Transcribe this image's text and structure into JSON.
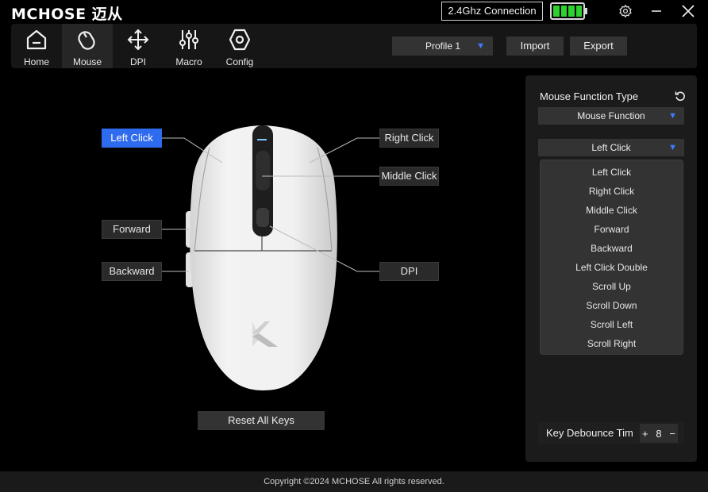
{
  "app": {
    "logo": "MCHOSE 迈从",
    "connection": "2.4Ghz Connection",
    "battery_level": 1.0,
    "battery_color": "#2ed12e"
  },
  "nav": {
    "items": [
      {
        "label": "Home",
        "icon": "home-icon"
      },
      {
        "label": "Mouse",
        "icon": "mouse-icon"
      },
      {
        "label": "DPI",
        "icon": "move-arrows-icon"
      },
      {
        "label": "Macro",
        "icon": "sliders-icon"
      },
      {
        "label": "Config",
        "icon": "hexagon-icon"
      }
    ],
    "active": "Mouse"
  },
  "toolbar": {
    "profile_value": "Profile  1",
    "import_label": "Import",
    "export_label": "Export"
  },
  "mouse": {
    "callouts": {
      "left_click": "Left Click",
      "right_click": "Right Click",
      "middle_click": "Middle Click",
      "forward": "Forward",
      "backward": "Backward",
      "dpi": "DPI"
    },
    "selected": "left_click",
    "reset_label": "Reset All Keys",
    "accent_color": "#2f6bef"
  },
  "panel": {
    "title": "Mouse Function Type",
    "type_value": "Mouse Function",
    "function_value": "Left Click",
    "options": [
      "Left Click",
      "Right Click",
      "Middle Click",
      "Forward",
      "Backward",
      "Left Click Double",
      "Scroll Up",
      "Scroll Down",
      "Scroll Left",
      "Scroll Right"
    ],
    "debounce_label": "Key Debounce Tim",
    "debounce_plus": "+",
    "debounce_value": "8",
    "debounce_minus": "−"
  },
  "footer": {
    "copyright": "Copyright ©2024 MCHOSE All rights reserved."
  }
}
